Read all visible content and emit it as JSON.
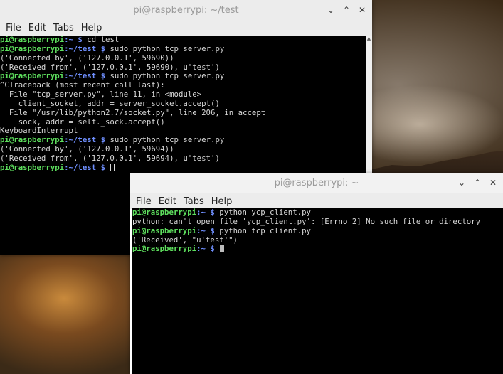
{
  "window_back": {
    "title": "pi@raspberrypi: ~/test",
    "menu": [
      "File",
      "Edit",
      "Tabs",
      "Help"
    ],
    "controls": {
      "minimize": "⌄",
      "maximize": "⌃",
      "close": "✕"
    },
    "lines": [
      {
        "user": "pi@raspberrypi",
        "path": ":~",
        "cmd": " cd test"
      },
      {
        "user": "pi@raspberrypi",
        "path": ":~/test",
        "cmd": " sudo python tcp_server.py"
      },
      {
        "text": "('Connected by', ('127.0.0.1', 59690))"
      },
      {
        "text": "('Received from', ('127.0.0.1', 59690), u'test')"
      },
      {
        "user": "pi@raspberrypi",
        "path": ":~/test",
        "cmd": " sudo python tcp_server.py"
      },
      {
        "text": "^CTraceback (most recent call last):"
      },
      {
        "text": "  File \"tcp_server.py\", line 11, in <module>"
      },
      {
        "text": "    client_socket, addr = server_socket.accept()"
      },
      {
        "text": "  File \"/usr/lib/python2.7/socket.py\", line 206, in accept"
      },
      {
        "text": "    sock, addr = self._sock.accept()"
      },
      {
        "text": "KeyboardInterrupt"
      },
      {
        "user": "pi@raspberrypi",
        "path": ":~/test",
        "cmd": " sudo python tcp_server.py"
      },
      {
        "text": "('Connected by', ('127.0.0.1', 59694))"
      },
      {
        "text": "('Received from', ('127.0.0.1', 59694), u'test')"
      },
      {
        "user": "pi@raspberrypi",
        "path": ":~/test",
        "cmd": " ",
        "cursor": "hollow"
      }
    ]
  },
  "window_front": {
    "title": "pi@raspberrypi: ~",
    "menu": [
      "File",
      "Edit",
      "Tabs",
      "Help"
    ],
    "controls": {
      "minimize": "⌄",
      "maximize": "⌃",
      "close": "✕"
    },
    "lines": [
      {
        "user": "pi@raspberrypi",
        "path": ":~",
        "cmd": " python ycp_client.py"
      },
      {
        "text": "python: can't open file 'ycp_client.py': [Errno 2] No such file or directory"
      },
      {
        "user": "pi@raspberrypi",
        "path": ":~",
        "cmd": " python tcp_client.py"
      },
      {
        "text": "('Received', \"u'test'\")"
      },
      {
        "user": "pi@raspberrypi",
        "path": ":~",
        "cmd": " ",
        "cursor": "solid"
      }
    ]
  },
  "colors": {
    "prompt_user": "#5ee05e",
    "prompt_path": "#6f8fff",
    "terminal_bg": "#000000"
  }
}
